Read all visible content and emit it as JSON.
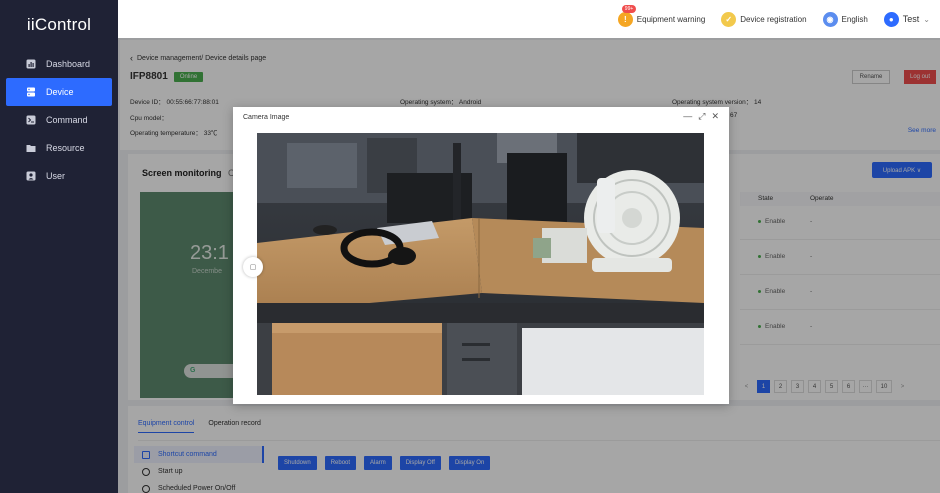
{
  "app": {
    "logo": "iiControl"
  },
  "sidebar": {
    "items": [
      {
        "label": "Dashboard",
        "icon": "dashboard-icon"
      },
      {
        "label": "Device",
        "icon": "device-icon",
        "active": true
      },
      {
        "label": "Command",
        "icon": "command-icon"
      },
      {
        "label": "Resource",
        "icon": "folder-icon"
      },
      {
        "label": "User",
        "icon": "user-icon"
      }
    ]
  },
  "topbar": {
    "warning_label": "Equipment warning",
    "warning_badge": "99+",
    "registration_label": "Device registration",
    "language_label": "English",
    "user_label": "Test"
  },
  "device": {
    "breadcrumb": "Device management/ Device details page",
    "name": "IFP8801",
    "status": "Online",
    "rename_label": "Rename",
    "logout_label": "Log out",
    "device_id": "Device ID： 00:55:66:77:88:01",
    "os": "Operating system： Android",
    "os_version": "Operating system version： 14",
    "cpu_model": "Cpu model：",
    "cpu_tail": "67",
    "temperature": "Operating temperature： 33℃",
    "see_more": "See more"
  },
  "screen": {
    "title": "Screen monitoring",
    "refresh_icon": "C",
    "time": "23:1",
    "date": "Decembe",
    "search_glyph": "G"
  },
  "apps_table": {
    "upload_label": "Upload APK ∨",
    "columns": [
      "State",
      "Operate"
    ],
    "rows": [
      {
        "state": "Enable",
        "operate": "-"
      },
      {
        "state": "Enable",
        "operate": "-"
      },
      {
        "state": "Enable",
        "operate": "-"
      },
      {
        "state": "Enable",
        "operate": "-"
      }
    ]
  },
  "pagination": {
    "prev": "<",
    "pages": [
      "1",
      "2",
      "3",
      "4",
      "5",
      "6",
      "···",
      "10"
    ],
    "next": ">",
    "current": "1"
  },
  "control": {
    "tabs": [
      "Equipment control",
      "Operation record"
    ],
    "side_items": [
      "Shortcut command",
      "Start up",
      "Scheduled Power On/Off"
    ],
    "buttons": [
      "Shutdown",
      "Reboot",
      "Alarm",
      "Display Off",
      "Display On"
    ]
  },
  "modal": {
    "title": "Camera Image",
    "minimize": "—",
    "maximize": "⤢",
    "close": "✕",
    "handle_glyph": "▢"
  },
  "colors": {
    "accent": "#2d6bff",
    "sidebar": "#1f2235",
    "online": "#4caf50",
    "danger": "#f04d4d"
  }
}
